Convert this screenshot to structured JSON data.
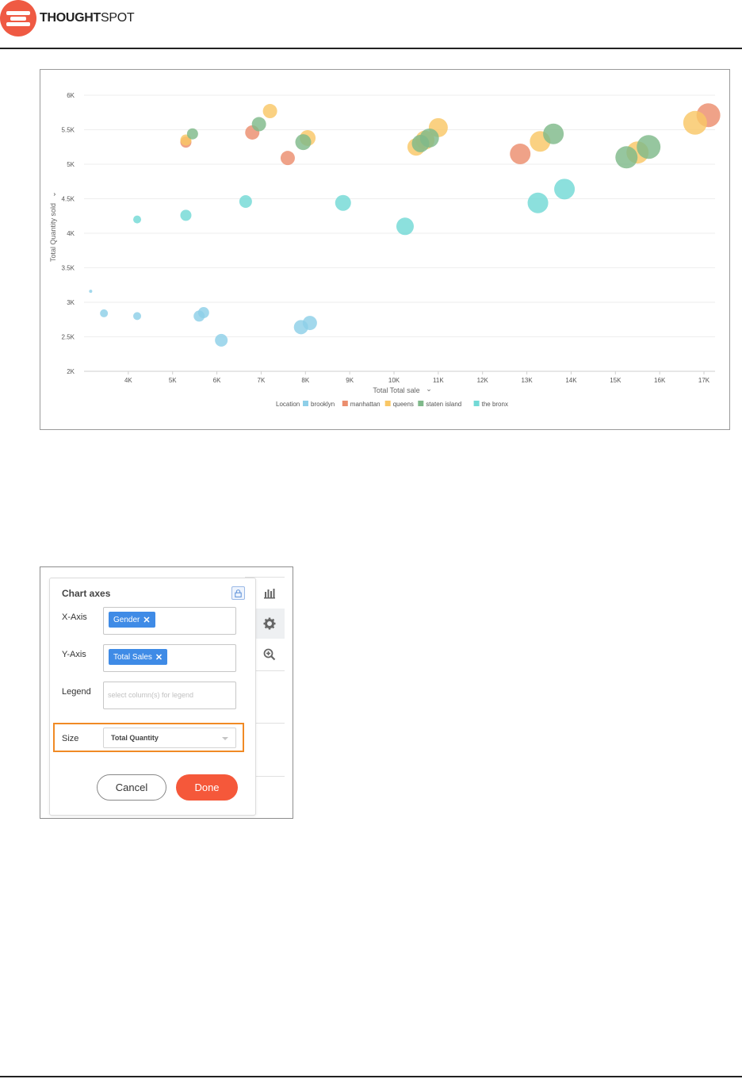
{
  "brand": {
    "name_bold": "THOUGHT",
    "name_light": "SPOT"
  },
  "chart_data": {
    "type": "scatter",
    "xlabel": "Total Total sale",
    "ylabel": "Total Quantity sold",
    "xlim": [
      3000,
      17250
    ],
    "ylim": [
      2000,
      6000
    ],
    "x_ticks": [
      4000,
      5000,
      6000,
      7000,
      8000,
      9000,
      10000,
      11000,
      12000,
      13000,
      14000,
      15000,
      16000,
      17000
    ],
    "x_tick_labels": [
      "4K",
      "5K",
      "6K",
      "7K",
      "8K",
      "9K",
      "10K",
      "11K",
      "12K",
      "13K",
      "14K",
      "15K",
      "16K",
      "17K"
    ],
    "y_ticks": [
      2000,
      2500,
      3000,
      3500,
      4000,
      4500,
      5000,
      5500,
      6000
    ],
    "y_tick_labels": [
      "2K",
      "2.5K",
      "3K",
      "3.5K",
      "4K",
      "4.5K",
      "5K",
      "5.5K",
      "6K"
    ],
    "legend_title": "Location",
    "legend_position": "bottom",
    "grid": true,
    "series": [
      {
        "name": "brooklyn",
        "color": "#8ecfe8",
        "points": [
          {
            "x": 3150,
            "y": 3160,
            "size": 0.5
          },
          {
            "x": 3450,
            "y": 2840,
            "size": 2
          },
          {
            "x": 4200,
            "y": 2800,
            "size": 2
          },
          {
            "x": 5600,
            "y": 2800,
            "size": 3
          },
          {
            "x": 5700,
            "y": 2850,
            "size": 3
          },
          {
            "x": 6100,
            "y": 2450,
            "size": 3.5
          },
          {
            "x": 7900,
            "y": 2640,
            "size": 4
          },
          {
            "x": 8100,
            "y": 2700,
            "size": 4
          }
        ]
      },
      {
        "name": "manhattan",
        "color": "#eb8e6e",
        "points": [
          {
            "x": 5300,
            "y": 5320,
            "size": 3
          },
          {
            "x": 6800,
            "y": 5460,
            "size": 4
          },
          {
            "x": 7600,
            "y": 5090,
            "size": 4
          },
          {
            "x": 12850,
            "y": 5150,
            "size": 6
          },
          {
            "x": 17100,
            "y": 5710,
            "size": 7
          }
        ]
      },
      {
        "name": "queens",
        "color": "#f9c766",
        "points": [
          {
            "x": 5300,
            "y": 5350,
            "size": 3
          },
          {
            "x": 7200,
            "y": 5770,
            "size": 4
          },
          {
            "x": 8050,
            "y": 5380,
            "size": 4.5
          },
          {
            "x": 10500,
            "y": 5250,
            "size": 5
          },
          {
            "x": 10700,
            "y": 5350,
            "size": 5.5
          },
          {
            "x": 11000,
            "y": 5530,
            "size": 5.5
          },
          {
            "x": 13300,
            "y": 5330,
            "size": 6
          },
          {
            "x": 15500,
            "y": 5170,
            "size": 6.5
          },
          {
            "x": 16800,
            "y": 5600,
            "size": 7
          }
        ]
      },
      {
        "name": "staten island",
        "color": "#7fb98a",
        "points": [
          {
            "x": 5450,
            "y": 5440,
            "size": 3
          },
          {
            "x": 6950,
            "y": 5580,
            "size": 4
          },
          {
            "x": 7950,
            "y": 5320,
            "size": 4.5
          },
          {
            "x": 10600,
            "y": 5300,
            "size": 5
          },
          {
            "x": 10800,
            "y": 5380,
            "size": 5.5
          },
          {
            "x": 13600,
            "y": 5440,
            "size": 6
          },
          {
            "x": 15250,
            "y": 5100,
            "size": 6.5
          },
          {
            "x": 15750,
            "y": 5250,
            "size": 7
          }
        ]
      },
      {
        "name": "the bronx",
        "color": "#73d9d6",
        "points": [
          {
            "x": 4200,
            "y": 4200,
            "size": 2
          },
          {
            "x": 5300,
            "y": 4260,
            "size": 3
          },
          {
            "x": 6650,
            "y": 4460,
            "size": 3.5
          },
          {
            "x": 8850,
            "y": 4440,
            "size": 4.5
          },
          {
            "x": 10250,
            "y": 4100,
            "size": 5
          },
          {
            "x": 13250,
            "y": 4440,
            "size": 6
          },
          {
            "x": 13850,
            "y": 4640,
            "size": 6
          }
        ]
      }
    ]
  },
  "dialog": {
    "title": "Chart axes",
    "xaxis_label": "X-Axis",
    "xaxis_chip": "Gender",
    "yaxis_label": "Y-Axis",
    "yaxis_chip": "Total Sales",
    "legend_label": "Legend",
    "legend_placeholder": "select column(s) for legend",
    "size_label": "Size",
    "size_value": "Total Quantity",
    "cancel_label": "Cancel",
    "done_label": "Done",
    "chip_remove_glyph": "✕",
    "highlight_color": "#f08a25",
    "done_color": "#f5583a",
    "chip_color": "#3f8be6"
  },
  "toolbar_icons": [
    "bar-chart-icon",
    "gear-icon",
    "zoom-in-icon"
  ]
}
